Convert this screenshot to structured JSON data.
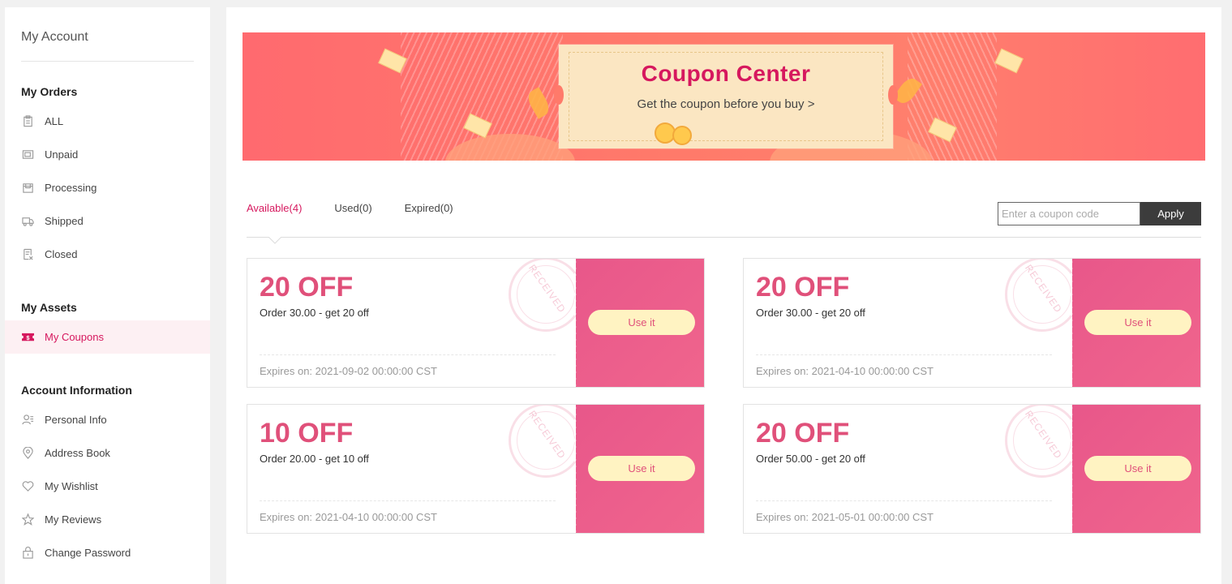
{
  "sidebar": {
    "account_title": "My Account",
    "orders_title": "My Orders",
    "orders": [
      {
        "label": "ALL",
        "icon": "clipboard-icon"
      },
      {
        "label": "Unpaid",
        "icon": "wallet-icon"
      },
      {
        "label": "Processing",
        "icon": "package-icon"
      },
      {
        "label": "Shipped",
        "icon": "truck-icon"
      },
      {
        "label": "Closed",
        "icon": "receipt-icon"
      }
    ],
    "assets_title": "My Assets",
    "assets": [
      {
        "label": "My Coupons",
        "icon": "coupon-icon",
        "active": true
      }
    ],
    "info_title": "Account Information",
    "info": [
      {
        "label": "Personal Info",
        "icon": "user-icon"
      },
      {
        "label": "Address Book",
        "icon": "location-pin-icon"
      },
      {
        "label": "My Wishlist",
        "icon": "heart-icon"
      },
      {
        "label": "My Reviews",
        "icon": "star-icon"
      },
      {
        "label": "Change Password",
        "icon": "lock-icon"
      }
    ]
  },
  "banner": {
    "title": "Coupon Center",
    "subtitle": "Get the coupon before you buy >"
  },
  "tabs": [
    {
      "label": "Available(4)",
      "active": true
    },
    {
      "label": "Used(0)",
      "active": false
    },
    {
      "label": "Expired(0)",
      "active": false
    }
  ],
  "coupon_code": {
    "placeholder": "Enter a coupon code",
    "value": "",
    "apply_label": "Apply"
  },
  "coupons": [
    {
      "amount": "20 OFF",
      "description": "Order 30.00 - get 20 off",
      "expires": "Expires on: 2021-09-02 00:00:00 CST",
      "stamp": "RECEIVED",
      "button": "Use it"
    },
    {
      "amount": "20 OFF",
      "description": "Order 30.00 - get 20 off",
      "expires": "Expires on: 2021-04-10 00:00:00 CST",
      "stamp": "RECEIVED",
      "button": "Use it"
    },
    {
      "amount": "10 OFF",
      "description": "Order 20.00 - get 10 off",
      "expires": "Expires on: 2021-04-10 00:00:00 CST",
      "stamp": "RECEIVED",
      "button": "Use it"
    },
    {
      "amount": "20 OFF",
      "description": "Order 50.00 - get 20 off",
      "expires": "Expires on: 2021-05-01 00:00:00 CST",
      "stamp": "RECEIVED",
      "button": "Use it"
    }
  ],
  "colors": {
    "accent": "#d6185e",
    "coupon_pink": "#e0507a",
    "use_button_bg": "#fff3c2",
    "apply_button_bg": "#3c3c3c",
    "active_nav_bg": "#fdf0f3"
  }
}
